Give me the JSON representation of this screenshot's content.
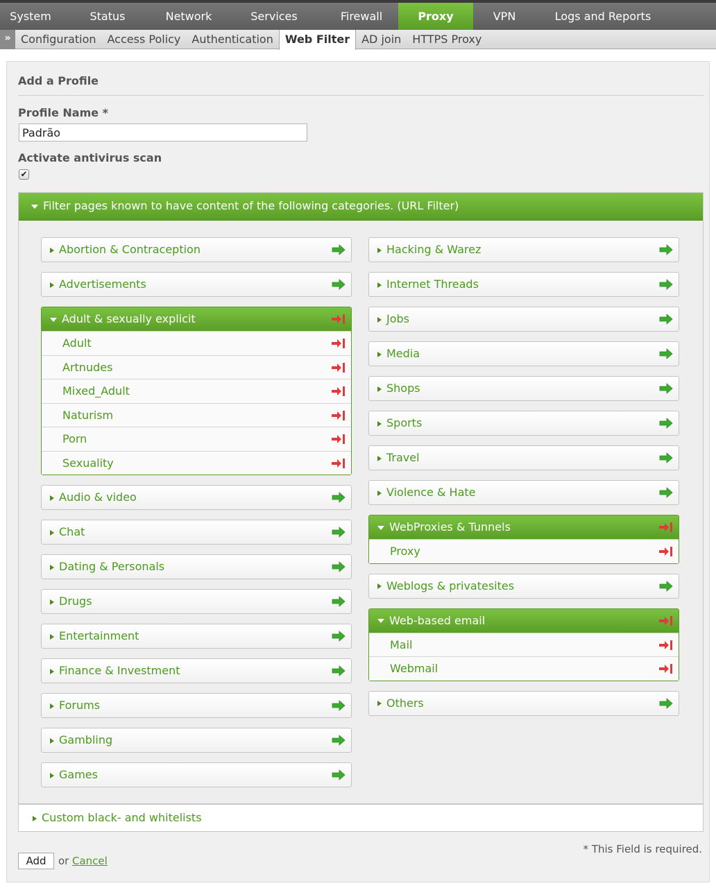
{
  "top_nav": {
    "items": [
      {
        "label": "System",
        "width": 88
      },
      {
        "label": "Status",
        "width": 134
      },
      {
        "label": "Network",
        "width": 100
      },
      {
        "label": "Services",
        "width": 146
      },
      {
        "label": "Firewall",
        "width": 106
      },
      {
        "label": "Proxy",
        "width": 108,
        "active": true
      },
      {
        "label": "VPN",
        "width": 90
      },
      {
        "label": "Logs and Reports",
        "width": 194
      }
    ]
  },
  "sub_nav": {
    "expander": "»",
    "tabs": [
      {
        "label": "Configuration"
      },
      {
        "label": "Access Policy"
      },
      {
        "label": "Authentication"
      },
      {
        "label": "Web Filter",
        "active": true
      },
      {
        "label": "AD join"
      },
      {
        "label": "HTTPS Proxy"
      }
    ]
  },
  "form": {
    "title": "Add a Profile",
    "profile_name_label": "Profile Name *",
    "profile_name_value": "Padrão",
    "antivirus_label": "Activate antivirus scan",
    "antivirus_checked": true
  },
  "url_filter": {
    "header": "Filter pages known to have content of the following categories. (URL Filter)",
    "left_column": [
      {
        "label": "Abortion & Contraception",
        "state": "allow"
      },
      {
        "label": "Advertisements",
        "state": "allow"
      },
      {
        "label": "Adult & sexually explicit",
        "state": "block",
        "expanded": true,
        "children": [
          {
            "label": "Adult",
            "state": "block"
          },
          {
            "label": "Artnudes",
            "state": "block"
          },
          {
            "label": "Mixed_Adult",
            "state": "block"
          },
          {
            "label": "Naturism",
            "state": "block"
          },
          {
            "label": "Porn",
            "state": "block"
          },
          {
            "label": "Sexuality",
            "state": "block"
          }
        ]
      },
      {
        "label": "Audio & video",
        "state": "allow"
      },
      {
        "label": "Chat",
        "state": "allow"
      },
      {
        "label": "Dating & Personals",
        "state": "allow"
      },
      {
        "label": "Drugs",
        "state": "allow"
      },
      {
        "label": "Entertainment",
        "state": "allow"
      },
      {
        "label": "Finance & Investment",
        "state": "allow"
      },
      {
        "label": "Forums",
        "state": "allow"
      },
      {
        "label": "Gambling",
        "state": "allow"
      },
      {
        "label": "Games",
        "state": "allow"
      }
    ],
    "right_column": [
      {
        "label": "Hacking & Warez",
        "state": "allow"
      },
      {
        "label": "Internet Threads",
        "state": "allow"
      },
      {
        "label": "Jobs",
        "state": "allow"
      },
      {
        "label": "Media",
        "state": "allow"
      },
      {
        "label": "Shops",
        "state": "allow"
      },
      {
        "label": "Sports",
        "state": "allow"
      },
      {
        "label": "Travel",
        "state": "allow"
      },
      {
        "label": "Violence & Hate",
        "state": "allow"
      },
      {
        "label": "WebProxies & Tunnels",
        "state": "block",
        "expanded": true,
        "children": [
          {
            "label": "Proxy",
            "state": "block"
          }
        ]
      },
      {
        "label": "Weblogs & privatesites",
        "state": "allow"
      },
      {
        "label": "Web-based email",
        "state": "block",
        "expanded": true,
        "children": [
          {
            "label": "Mail",
            "state": "block"
          },
          {
            "label": "Webmail",
            "state": "block"
          }
        ]
      },
      {
        "label": "Others",
        "state": "allow"
      }
    ]
  },
  "custom_lists": {
    "label": "Custom black- and whitelists"
  },
  "footer": {
    "required_note": "* This Field is required.",
    "add_label": "Add",
    "or_text": "or",
    "cancel_label": "Cancel"
  },
  "colors": {
    "accent_green": "#5a9e26",
    "allow_icon": "#3cab2f",
    "block_icon": "#e03a3a"
  }
}
